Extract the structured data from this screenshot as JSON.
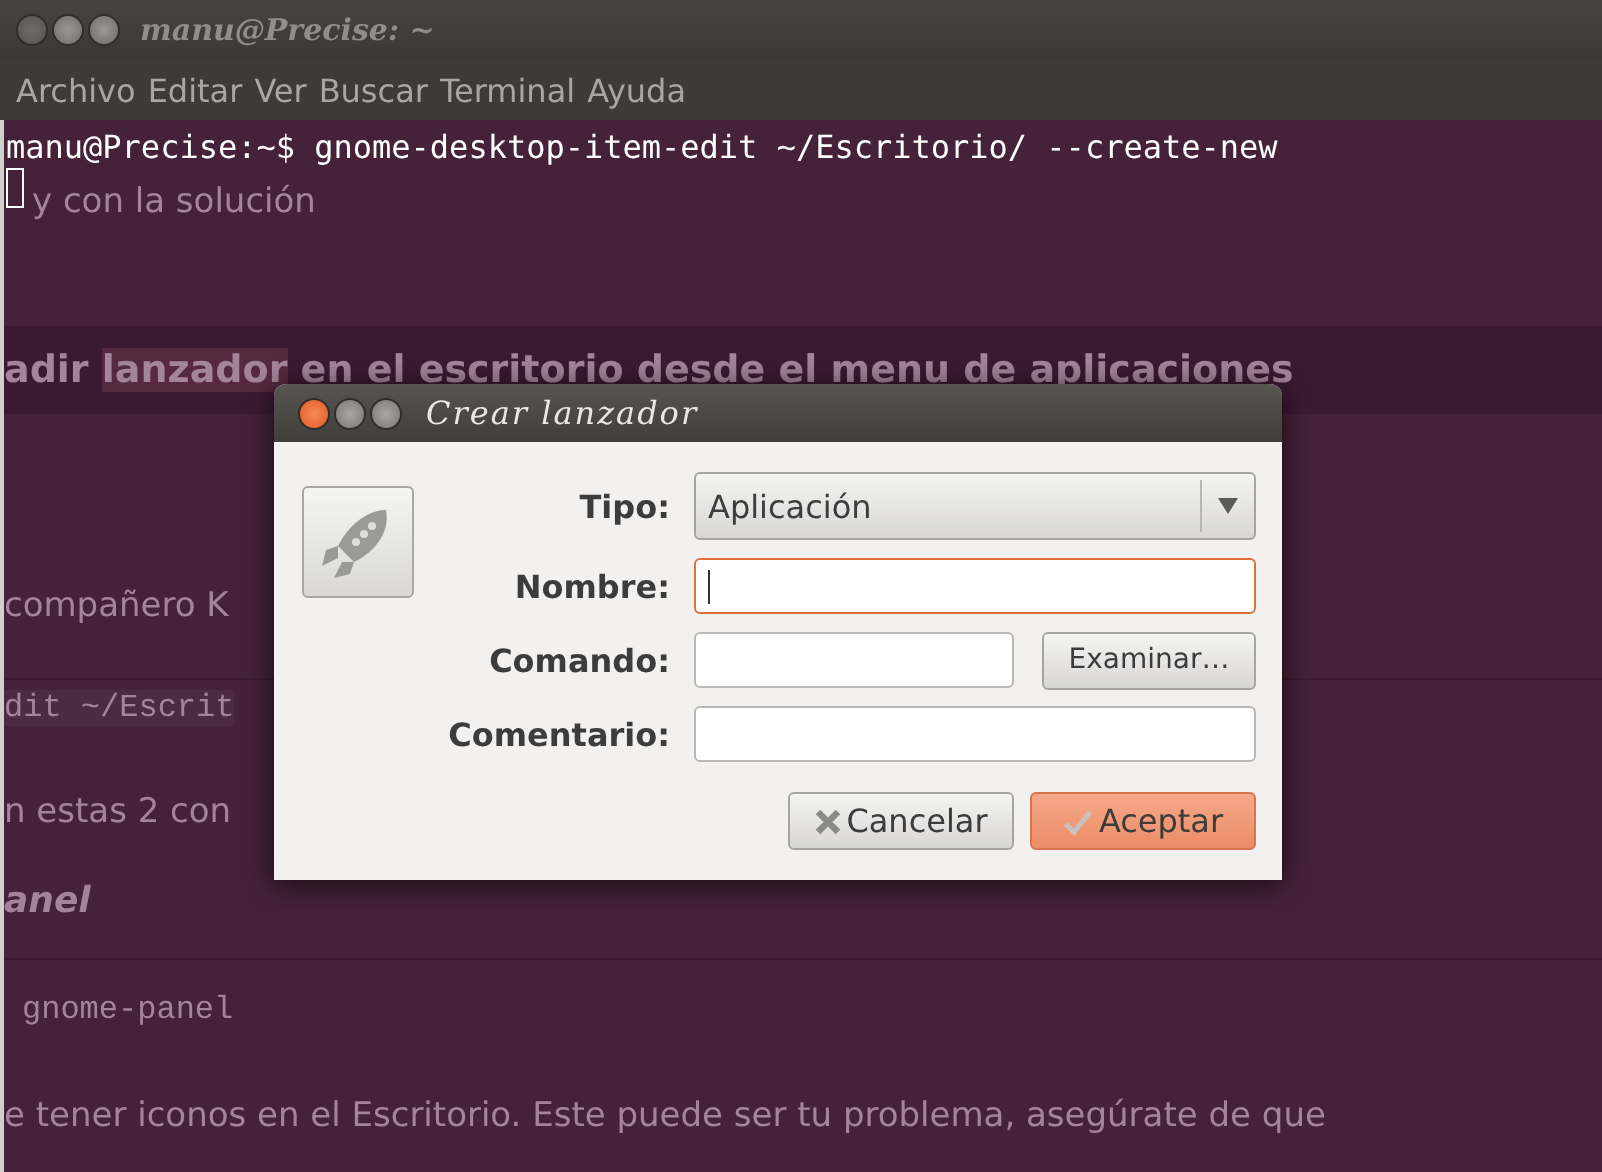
{
  "terminal": {
    "title": "manu@Precise: ~",
    "menu": [
      "Archivo",
      "Editar",
      "Ver",
      "Buscar",
      "Terminal",
      "Ayuda"
    ],
    "lines": [
      "manu@Precise:~$ gnome-desktop-item-edit ~/Escritorio/ --create-new"
    ]
  },
  "background_page": [
    {
      "kind": "text",
      "text": "y con la solución"
    },
    {
      "kind": "heading",
      "before": "adir ",
      "highlighted": "lanzador",
      "after": " en el escritorio desde el menu de aplicaciones"
    },
    {
      "kind": "text",
      "text": "compañero K"
    },
    {
      "kind": "code",
      "text": "dit ~/Escrit"
    },
    {
      "kind": "text",
      "text": "n estas 2 con"
    },
    {
      "kind": "subheading",
      "text": "anel"
    },
    {
      "kind": "code",
      "text": "gnome-panel"
    },
    {
      "kind": "text",
      "text": "e tener iconos en el Escritorio. Este puede ser tu problema, asegúrate de que"
    }
  ],
  "dialog": {
    "title": "Crear lanzador",
    "fields": [
      {
        "kind": "combo",
        "label": "Tipo:",
        "value": "Aplicación"
      },
      {
        "kind": "text",
        "label": "Nombre:",
        "focused": true
      },
      {
        "kind": "browse",
        "label": "Comando:",
        "button": "Examinar…"
      },
      {
        "kind": "text",
        "label": "Comentario:",
        "focused": false
      }
    ],
    "buttons": [
      {
        "kind": "cancel",
        "label": "Cancelar",
        "default": false
      },
      {
        "kind": "ok",
        "label": "Aceptar",
        "default": true
      }
    ]
  }
}
